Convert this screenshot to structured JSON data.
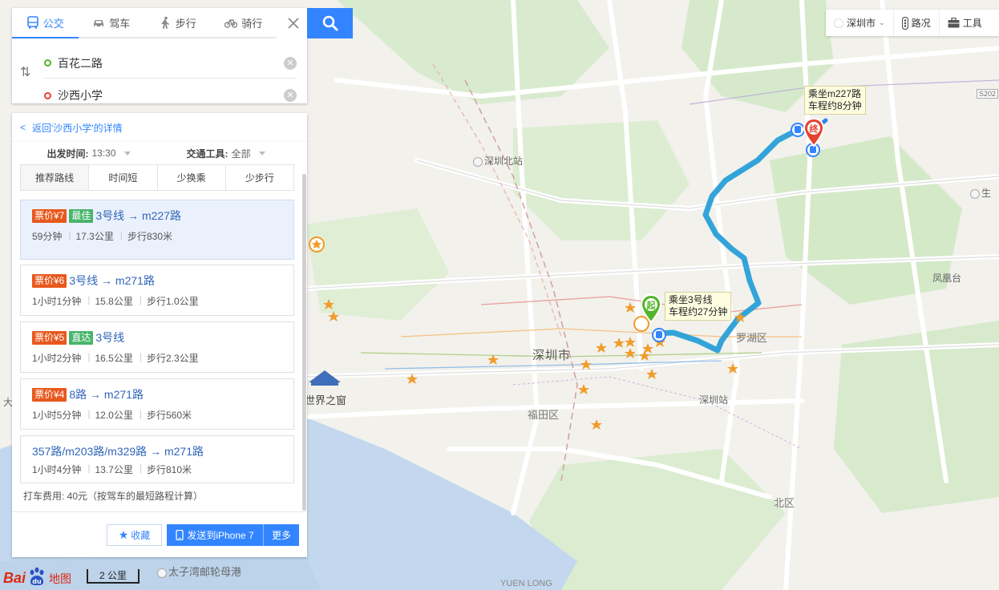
{
  "search": {
    "modes": [
      {
        "label": "公交",
        "icon": "bus-icon",
        "active": true
      },
      {
        "label": "驾车",
        "icon": "car-icon",
        "active": false
      },
      {
        "label": "步行",
        "icon": "walk-icon",
        "active": false
      },
      {
        "label": "骑行",
        "icon": "bike-icon",
        "active": false
      }
    ],
    "start_value": "百花二路",
    "end_value": "沙西小学"
  },
  "back_link": "返回'沙西小学'的详情",
  "filters": {
    "depart_label": "出发时间:",
    "depart_value": "13:30",
    "tool_label": "交通工具:",
    "tool_value": "全部"
  },
  "sort_tabs": [
    "推荐路线",
    "时间短",
    "少换乘",
    "少步行"
  ],
  "plans": [
    {
      "price": "票价¥7",
      "tag": "最佳",
      "route": "3号线 → m227路",
      "time": "59分钟",
      "dist": "17.3公里",
      "walk": "步行830米"
    },
    {
      "price": "票价¥6",
      "tag": "",
      "route": "3号线 → m271路",
      "time": "1小时1分钟",
      "dist": "15.8公里",
      "walk": "步行1.0公里"
    },
    {
      "price": "票价¥5",
      "tag": "直达",
      "route": "3号线",
      "time": "1小时2分钟",
      "dist": "16.5公里",
      "walk": "步行2.3公里"
    },
    {
      "price": "票价¥4",
      "tag": "",
      "route": "8路 → m271路",
      "time": "1小时5分钟",
      "dist": "12.0公里",
      "walk": "步行560米"
    },
    {
      "price": "",
      "tag": "",
      "route": "357路/m203路/m329路 → m271路",
      "time": "1小时4分钟",
      "dist": "13.7公里",
      "walk": "步行810米"
    }
  ],
  "taxi_note": "打车费用: 40元（按驾车的最短路程计算）",
  "footer": {
    "fav": "收藏",
    "send": "发送到iPhone 7",
    "more": "更多"
  },
  "toolbar": {
    "city": "深圳市",
    "traffic": "路况",
    "tools": "工具"
  },
  "map": {
    "labels": {
      "shenzhen_north": "深圳北站",
      "city": "深圳市",
      "futian": "福田区",
      "luohu_partial": "罗湖区",
      "shenzhen_station": "深圳站",
      "fenghuangtai": "凤凰台",
      "window_world": "世界之窗",
      "taizi": "太子湾邮轮母港",
      "yuen_long": "YUEN LONG",
      "north_district": "北区",
      "da": "大",
      "sheng": "生",
      "s202": "S202"
    },
    "callout_start": [
      "乘坐3号线",
      "车程约27分钟"
    ],
    "callout_end": [
      "乘坐m227路",
      "车程约8分钟"
    ],
    "start_pin": "起",
    "end_pin": "终"
  },
  "logo": {
    "bai": "Bai",
    "du": "du",
    "map": "地图"
  },
  "scale": "2 公里",
  "colors": {
    "accent": "#3385ff",
    "price": "#e8581d",
    "tag": "#48b56c",
    "route": "#1e9bd7"
  }
}
